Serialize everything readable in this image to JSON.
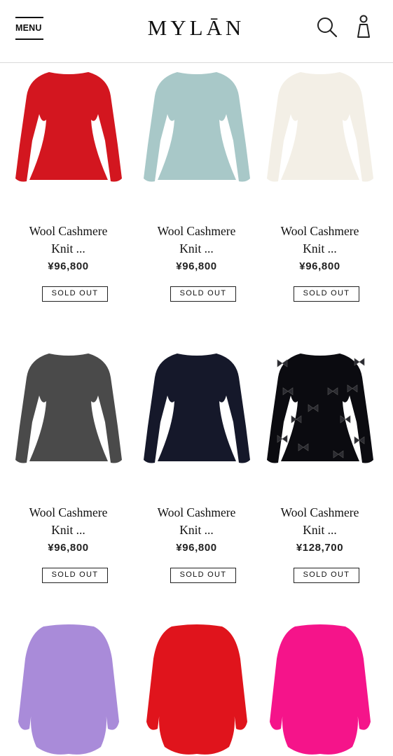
{
  "header": {
    "menu_label": "MENU",
    "logo": "MYLĀN"
  },
  "products": [
    {
      "name_line1": "Wool Cashmere",
      "name_line2": "Knit ...",
      "price": "¥96,800",
      "status": "SOLD OUT",
      "color": "#d3161f",
      "style": "fitted"
    },
    {
      "name_line1": "Wool Cashmere",
      "name_line2": "Knit ...",
      "price": "¥96,800",
      "status": "SOLD OUT",
      "color": "#a8c8c8",
      "style": "fitted"
    },
    {
      "name_line1": "Wool Cashmere",
      "name_line2": "Knit ...",
      "price": "¥96,800",
      "status": "SOLD OUT",
      "color": "#f3efe6",
      "style": "fitted"
    },
    {
      "name_line1": "Wool Cashmere",
      "name_line2": "Knit ...",
      "price": "¥96,800",
      "status": "SOLD OUT",
      "color": "#4a4a4a",
      "style": "fitted"
    },
    {
      "name_line1": "Wool Cashmere",
      "name_line2": "Knit ...",
      "price": "¥96,800",
      "status": "SOLD OUT",
      "color": "#15182a",
      "style": "fitted"
    },
    {
      "name_line1": "Wool Cashmere",
      "name_line2": "Knit ...",
      "price": "¥128,700",
      "status": "SOLD OUT",
      "color": "#0b0b10",
      "style": "bows"
    },
    {
      "color": "#a98bd9",
      "style": "draped"
    },
    {
      "color": "#e0141c",
      "style": "draped"
    },
    {
      "color": "#f5148a",
      "style": "draped"
    }
  ]
}
